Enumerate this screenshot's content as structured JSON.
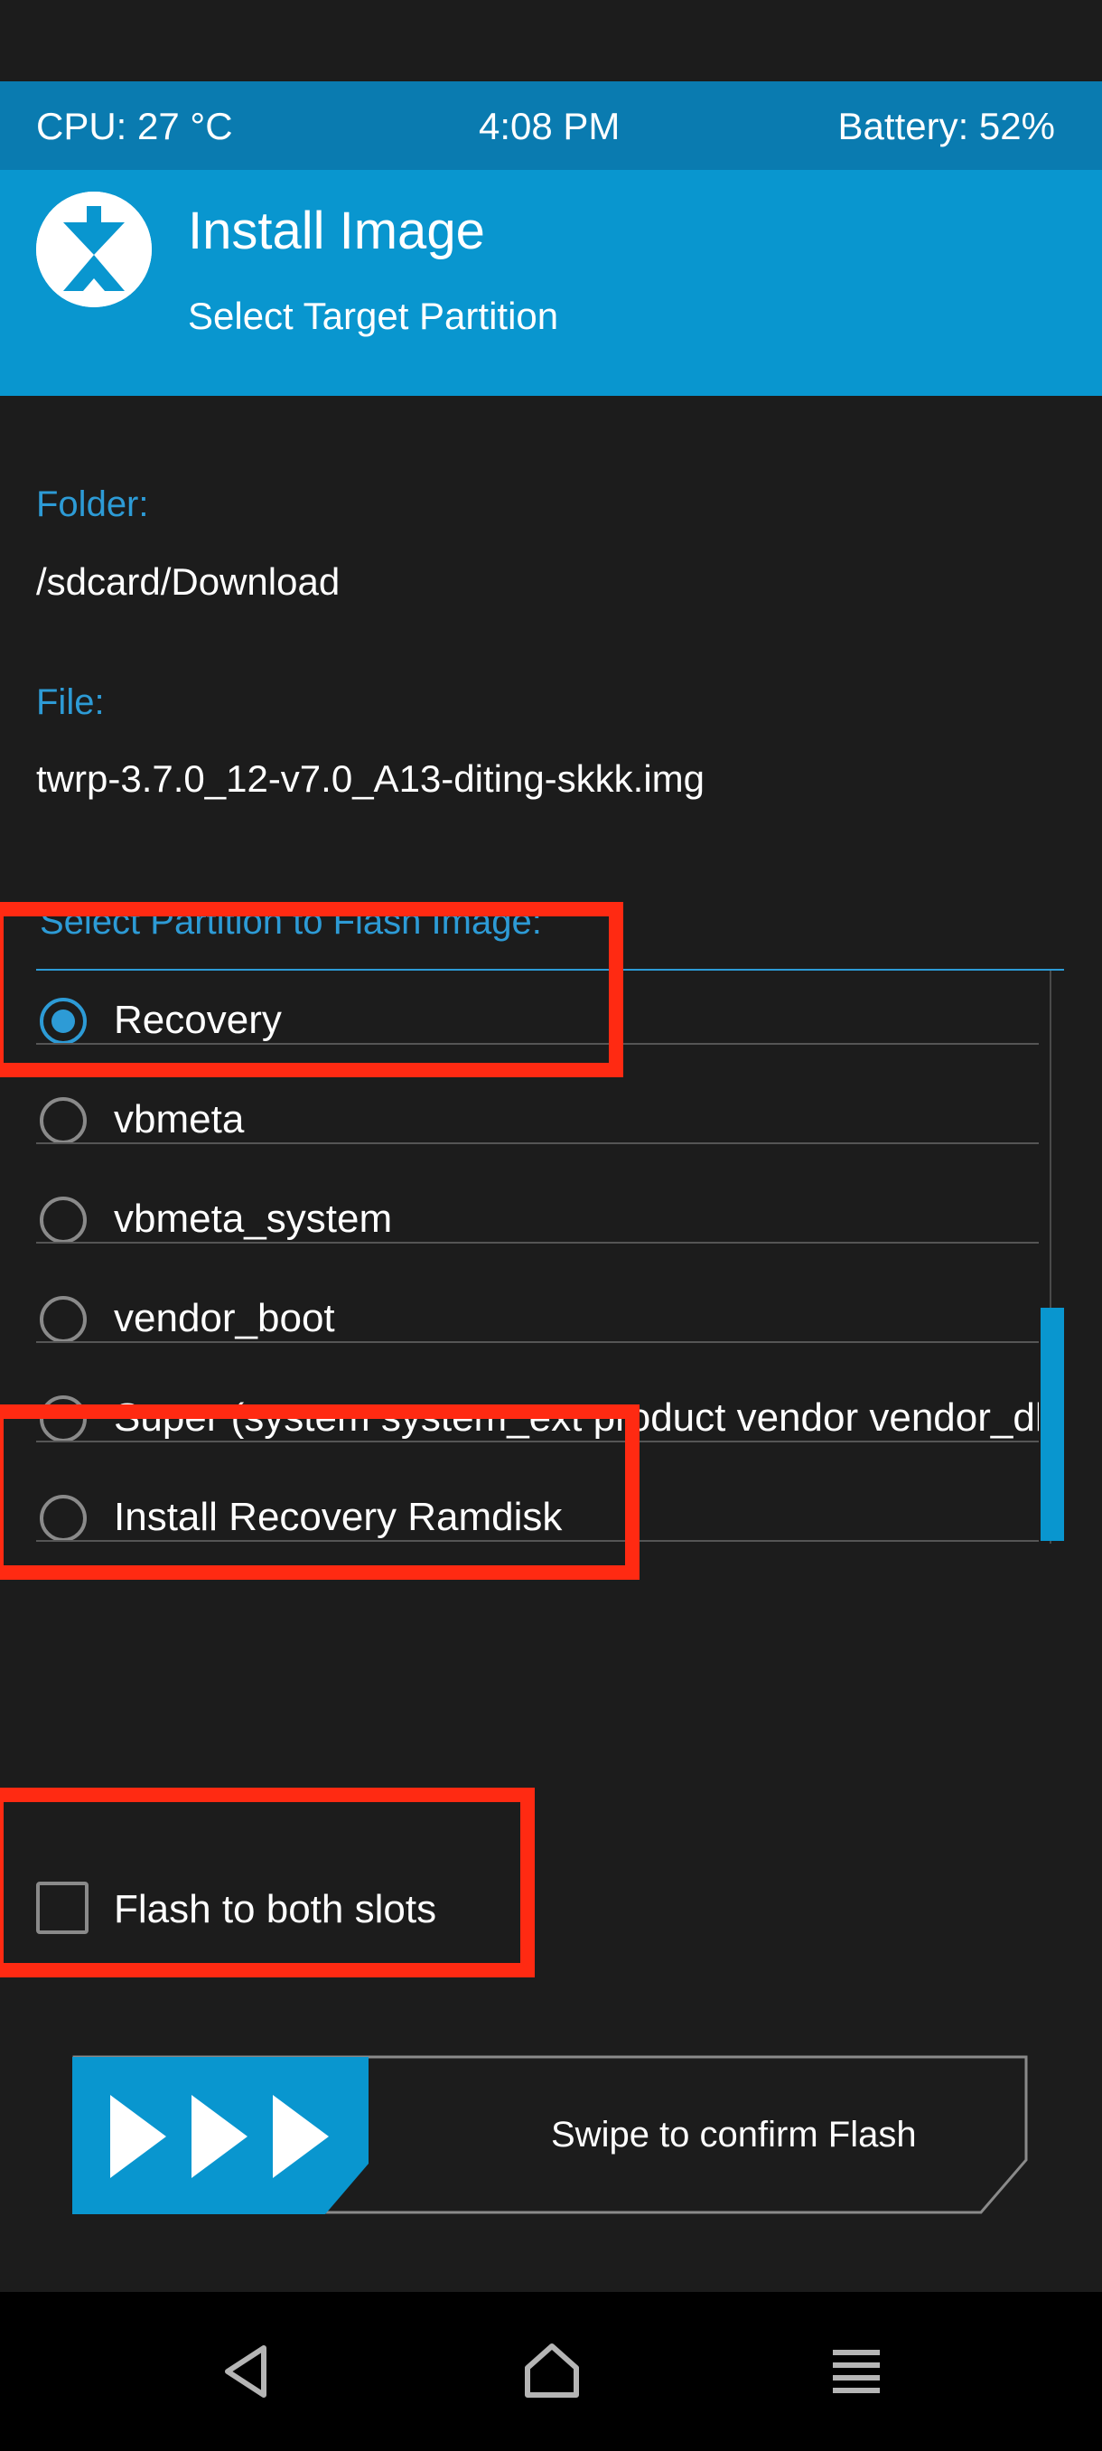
{
  "status_bar": {
    "cpu": "CPU: 27 °C",
    "time": "4:08 PM",
    "battery": "Battery: 52%"
  },
  "header": {
    "title": "Install Image",
    "subtitle": "Select Target Partition"
  },
  "folder": {
    "label": "Folder:",
    "value": "/sdcard/Download"
  },
  "file": {
    "label": "File:",
    "value": "twrp-3.7.0_12-v7.0_A13-diting-skkk.img"
  },
  "partition_select": {
    "label": "Select Partition to Flash Image:",
    "items": [
      {
        "label": "Recovery",
        "selected": true
      },
      {
        "label": "vbmeta",
        "selected": false
      },
      {
        "label": "vbmeta_system",
        "selected": false
      },
      {
        "label": "vendor_boot",
        "selected": false
      },
      {
        "label": "Super (system system_ext product vendor vendor_dlkm odm)",
        "selected": false
      },
      {
        "label": "Install Recovery Ramdisk",
        "selected": false
      }
    ]
  },
  "flash_both_slots": {
    "label": "Flash to both slots",
    "checked": false
  },
  "swipe": {
    "label": "Swipe to confirm Flash"
  },
  "nav": {
    "icons": [
      "back-icon",
      "home-icon",
      "menu-icon"
    ]
  },
  "colors": {
    "accent": "#0996cf",
    "status_bar": "#0a7bb0",
    "highlight": "#ff2a12",
    "background": "#1c1c1c"
  }
}
